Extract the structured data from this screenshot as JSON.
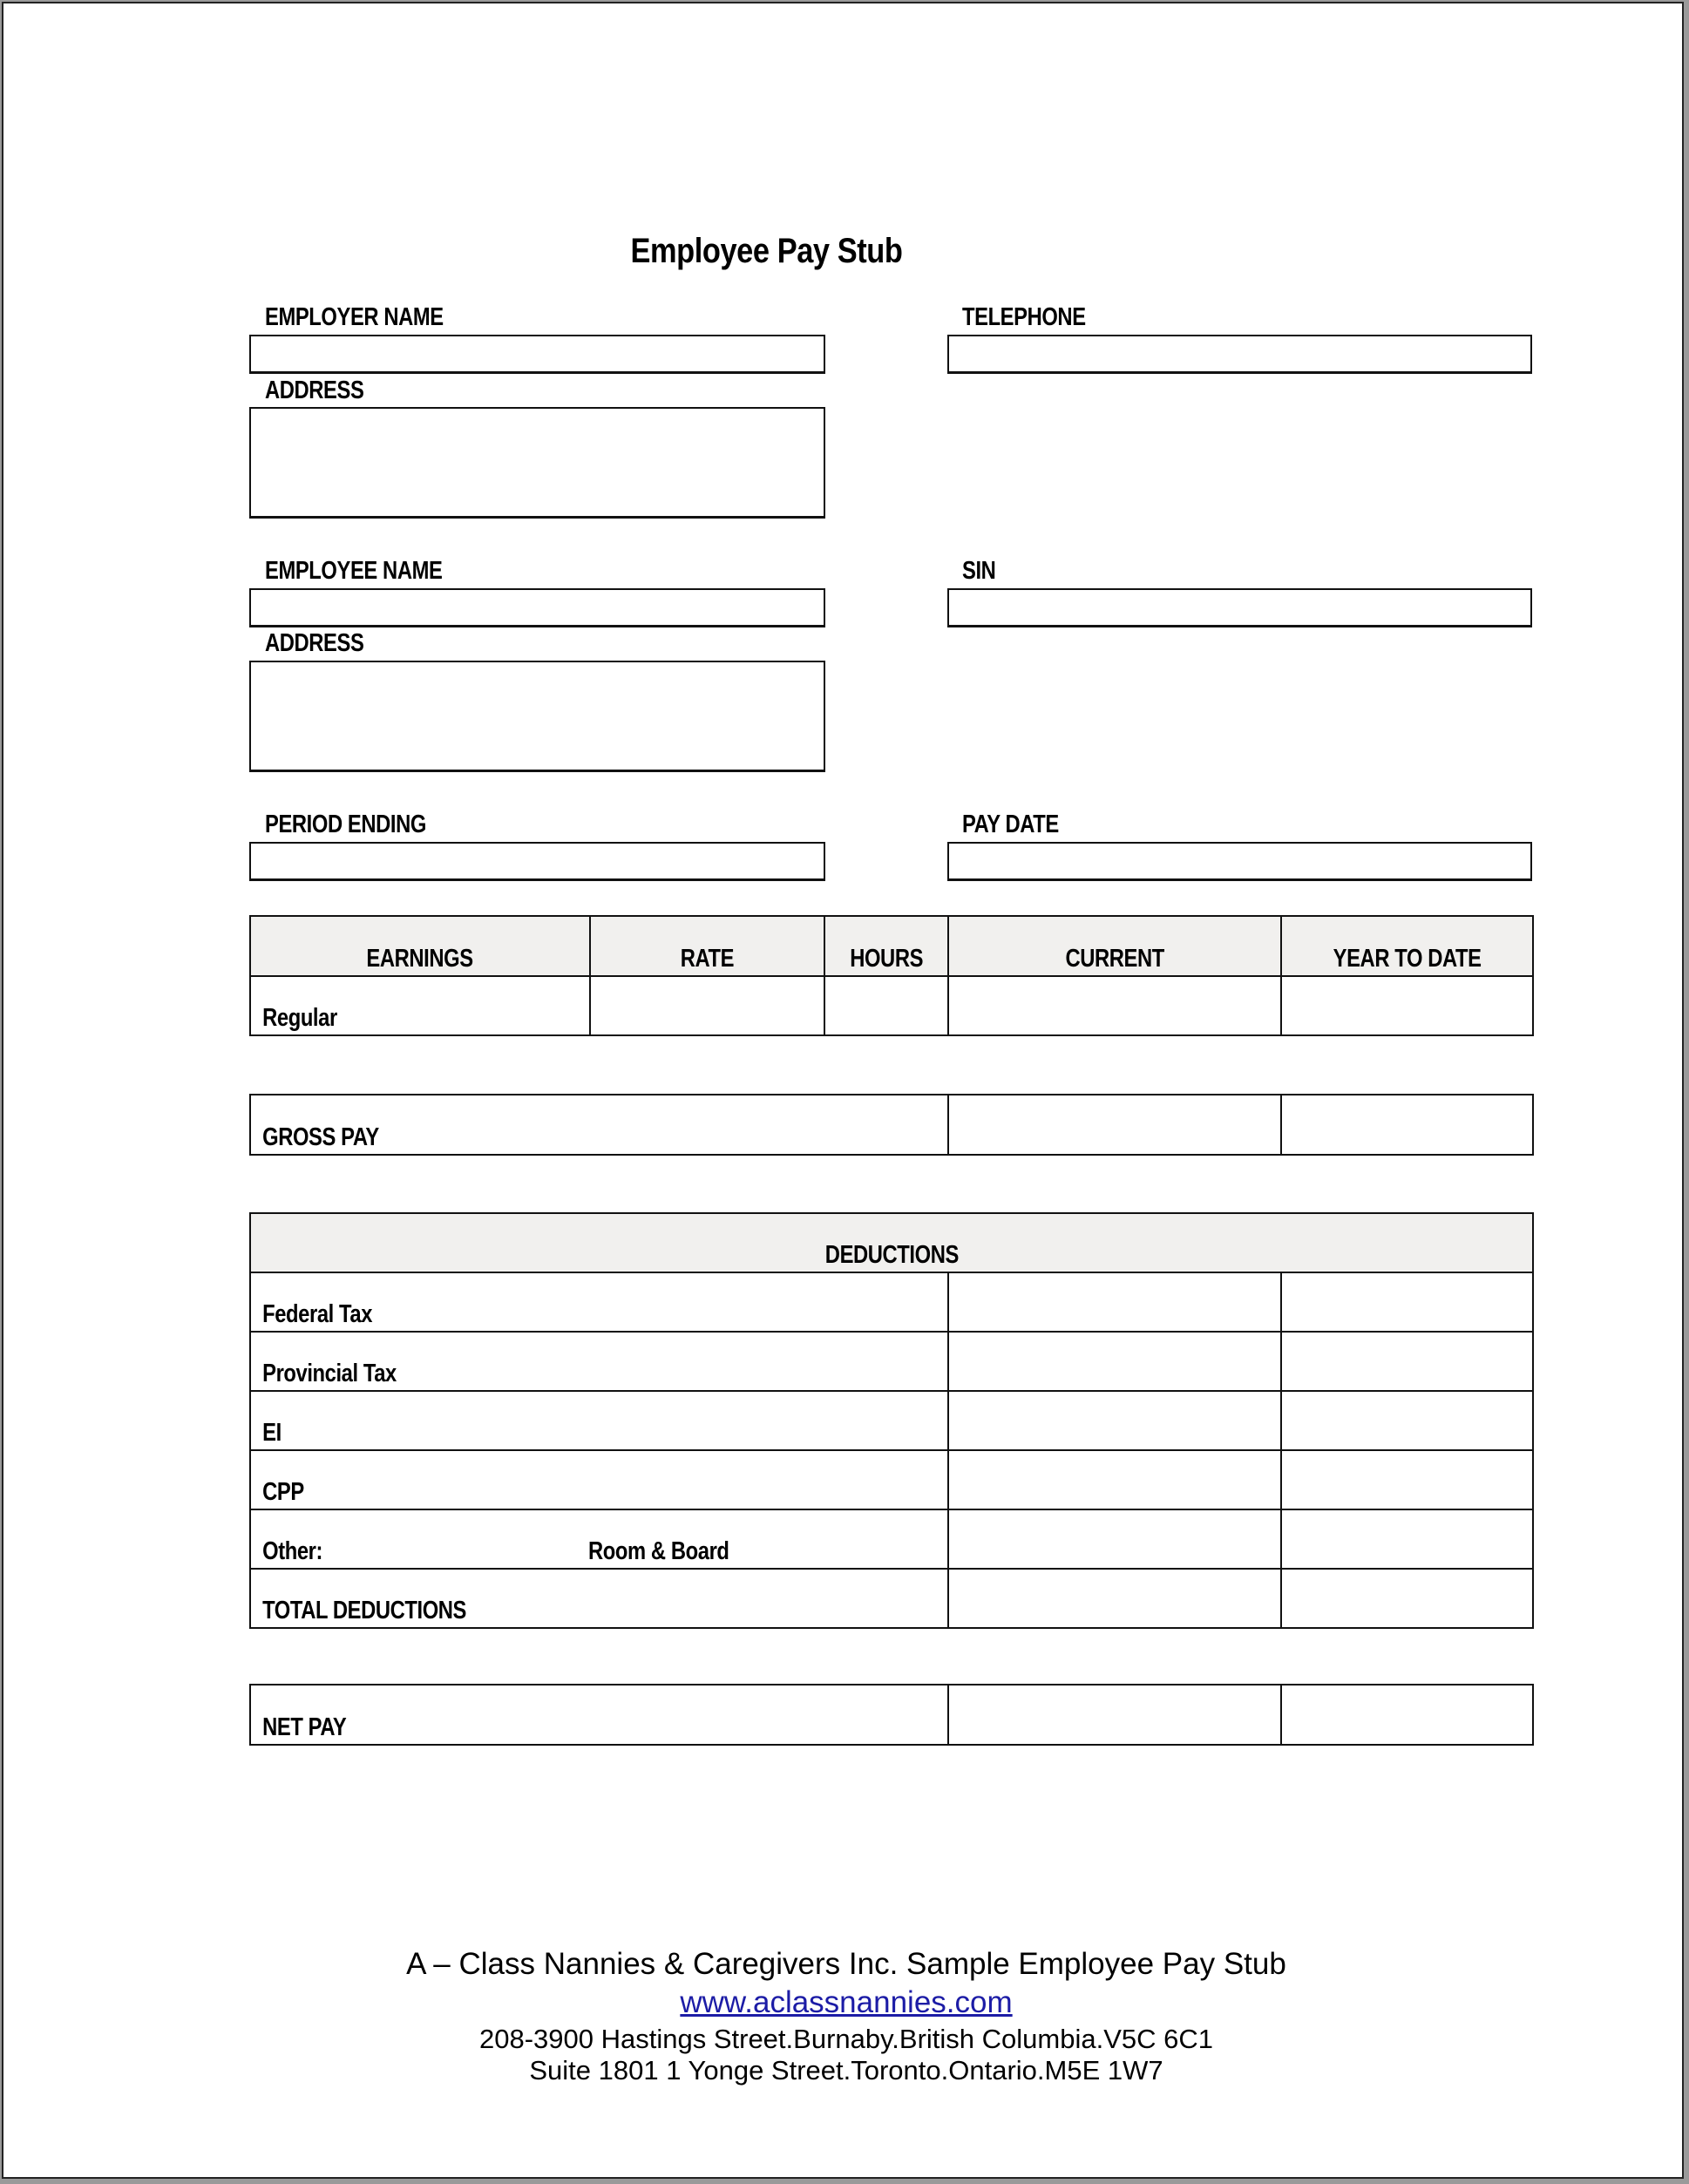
{
  "document": {
    "title": "Employee Pay Stub"
  },
  "employer": {
    "name_label": "EMPLOYER NAME",
    "name_value": "",
    "telephone_label": "TELEPHONE",
    "telephone_value": "",
    "address_label": "ADDRESS",
    "address_value": ""
  },
  "employee": {
    "name_label": "EMPLOYEE NAME",
    "name_value": "",
    "sin_label": "SIN",
    "sin_value": "",
    "address_label": "ADDRESS",
    "address_value": ""
  },
  "period": {
    "period_ending_label": "PERIOD ENDING",
    "period_ending_value": "",
    "pay_date_label": "PAY DATE",
    "pay_date_value": ""
  },
  "earnings": {
    "headers": [
      "EARNINGS",
      "RATE",
      "HOURS",
      "CURRENT",
      "YEAR TO DATE"
    ],
    "rows": [
      {
        "label": "Regular",
        "rate": "",
        "hours": "",
        "current": "",
        "ytd": ""
      }
    ]
  },
  "gross_pay": {
    "label": "GROSS PAY",
    "current": "",
    "ytd": ""
  },
  "deductions": {
    "header": "DEDUCTIONS",
    "rows": [
      {
        "label": "Federal Tax",
        "note": "",
        "current": "",
        "ytd": ""
      },
      {
        "label": "Provincial Tax",
        "note": "",
        "current": "",
        "ytd": ""
      },
      {
        "label": "EI",
        "note": "",
        "current": "",
        "ytd": ""
      },
      {
        "label": "CPP",
        "note": "",
        "current": "",
        "ytd": ""
      },
      {
        "label": "Other:",
        "note": "Room & Board",
        "current": "",
        "ytd": ""
      },
      {
        "label": "TOTAL DEDUCTIONS",
        "note": "",
        "current": "",
        "ytd": ""
      }
    ]
  },
  "net_pay": {
    "label": "NET PAY",
    "current": "",
    "ytd": ""
  },
  "footer": {
    "company_line": "A – Class Nannies & Caregivers Inc. Sample Employee Pay Stub",
    "website": "www.aclassnannies.com",
    "address_line_1": "208-3900 Hastings Street.Burnaby.British Columbia.V5C 6C1",
    "address_line_2": "Suite 1801 1 Yonge Street.Toronto.Ontario.M5E 1W7"
  },
  "colors": {
    "header_fill": "#f1f0ee",
    "link": "#1c1ca6",
    "border": "#111111"
  }
}
